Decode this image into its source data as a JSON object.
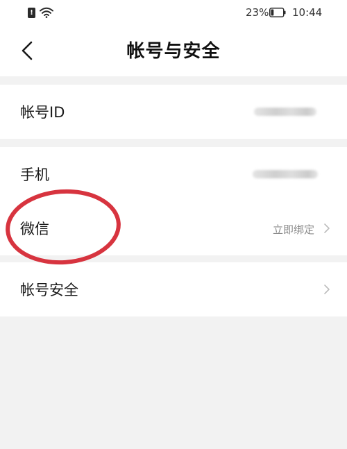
{
  "status_bar": {
    "sim_glyph": "!",
    "battery_percent": "23%",
    "battery_level": 0.23,
    "time": "10:44"
  },
  "header": {
    "title": "帐号与安全",
    "back_icon": "chevron-left-icon"
  },
  "rows": {
    "account_id": {
      "label": "帐号ID"
    },
    "phone": {
      "label": "手机"
    },
    "wechat": {
      "label": "微信",
      "value": "立即绑定"
    },
    "account_security": {
      "label": "帐号安全"
    }
  },
  "colors": {
    "annotation": "#d7343f",
    "background": "#f2f2f2",
    "card": "#ffffff",
    "secondary_text": "#8a8a8a",
    "chevron": "#bdbdbd"
  }
}
